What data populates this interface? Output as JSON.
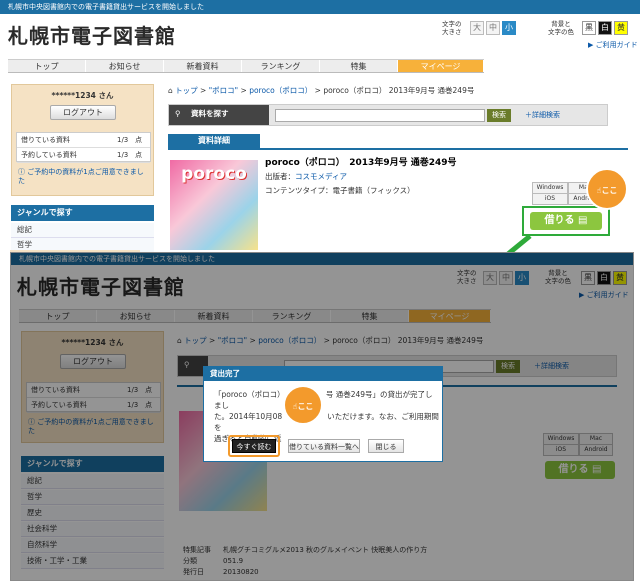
{
  "top_notice": "札幌市中央図書館内での電子書籍貸出サービスを開始しました",
  "logo": "札幌市電子図書館",
  "text_size": {
    "label_l1": "文字の",
    "label_l2": "大きさ",
    "small": "大",
    "mid": "中",
    "large": "小"
  },
  "text_color": {
    "label_l1": "背景と",
    "label_l2": "文字の色",
    "opt1": "黒",
    "opt2": "白",
    "opt3": "黄"
  },
  "guide_link": "ご利用ガイド",
  "nav": {
    "top": "トップ",
    "news": "お知らせ",
    "new": "新着資料",
    "ranking": "ランキング",
    "feature": "特集",
    "mypage": "マイページ"
  },
  "user": {
    "name": "******1234 さん",
    "logout": "ログアウト"
  },
  "lending": {
    "label": "借りている資料",
    "count": "1/3",
    "unit": "点"
  },
  "reserve": {
    "label": "予約している資料",
    "count": "1/3",
    "unit": "点"
  },
  "reserve_note": "ご予約中の資料が1点ご用意できました",
  "genre": {
    "title": "ジャンルで探す",
    "items": [
      "総記",
      "哲学",
      "歴史",
      "社会科学",
      "自然科学",
      "技術・工学・工業"
    ]
  },
  "breadcrumb": {
    "top": "トップ",
    "q": "\"ポロコ\"",
    "series": "poroco（ポロコ）",
    "current": "poroco（ポロコ） 2013年9月号 通巻249号"
  },
  "search": {
    "label": "資料を探す",
    "button": "検索",
    "advanced": "詳細検索"
  },
  "detail": {
    "tab": "資料詳細",
    "title": "poroco（ポロコ）　2013年9月号 通巻249号",
    "publisher_label": "出版者：",
    "publisher": "コスモメディア",
    "content_type_label": "コンテンツタイプ：",
    "content_type": "電子書籍（フィックス）",
    "os": [
      "Windows",
      "Mac",
      "iOS",
      "Android"
    ],
    "borrow": "借りる",
    "cover_title": "poroco"
  },
  "callout": "ここ",
  "dialog": {
    "title": "貸出完了",
    "body_l1": "「poroco（ポロコ）　　　　　　号 通巻249号」の貸出が完了しまし",
    "body_l2": "た。2014年10月08　　　　　　いただけます。なお、ご利用期間を",
    "body_l3": "過ぎると自動的に返",
    "read_now": "今すぐ読む",
    "lending_list": "借りている資料一覧へ",
    "close": "閉じる"
  },
  "meta": {
    "feature_label": "特集記事",
    "feature": "札幌グチコミグルメ2013 秋のグルメイベント 快眠美人の作り方",
    "class_label": "分類",
    "class": "051.9",
    "date_label": "発行日",
    "date": "20130820"
  },
  "colors": {
    "accent": "#1d6fa3",
    "mypage": "#f7b13a",
    "borrow": "#8cc63f",
    "callout": "#f39a2c"
  }
}
